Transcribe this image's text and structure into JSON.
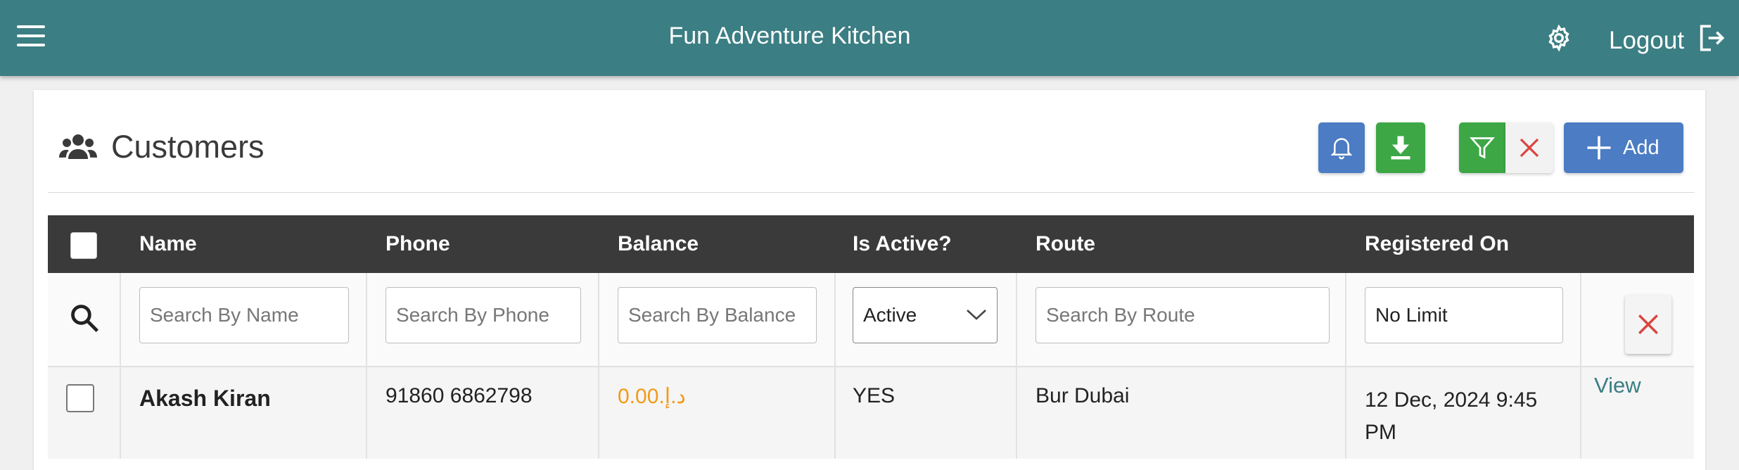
{
  "header": {
    "title": "Fun Adventure Kitchen",
    "logout_label": "Logout"
  },
  "page": {
    "title": "Customers",
    "add_label": "Add"
  },
  "table": {
    "columns": [
      "Name",
      "Phone",
      "Balance",
      "Is Active?",
      "Route",
      "Registered On"
    ],
    "filters": {
      "name_placeholder": "Search By Name",
      "phone_placeholder": "Search By Phone",
      "balance_placeholder": "Search By Balance",
      "active_value": "Active",
      "route_placeholder": "Search By Route",
      "registered_value": "No Limit"
    },
    "rows": [
      {
        "name": "Akash Kiran",
        "phone": "91860 6862798",
        "balance": "0.00.د.إ",
        "is_active": "YES",
        "route": "Bur Dubai",
        "registered_on": "12 Dec, 2024 9:45 PM",
        "action": "View"
      }
    ]
  },
  "colors": {
    "header_bg": "#3b7e83",
    "table_head_bg": "#3a3a3a",
    "primary_blue": "#4b7cc4",
    "success_green": "#3da746",
    "danger_red": "#d9443f",
    "balance_orange": "#f29a1a"
  }
}
